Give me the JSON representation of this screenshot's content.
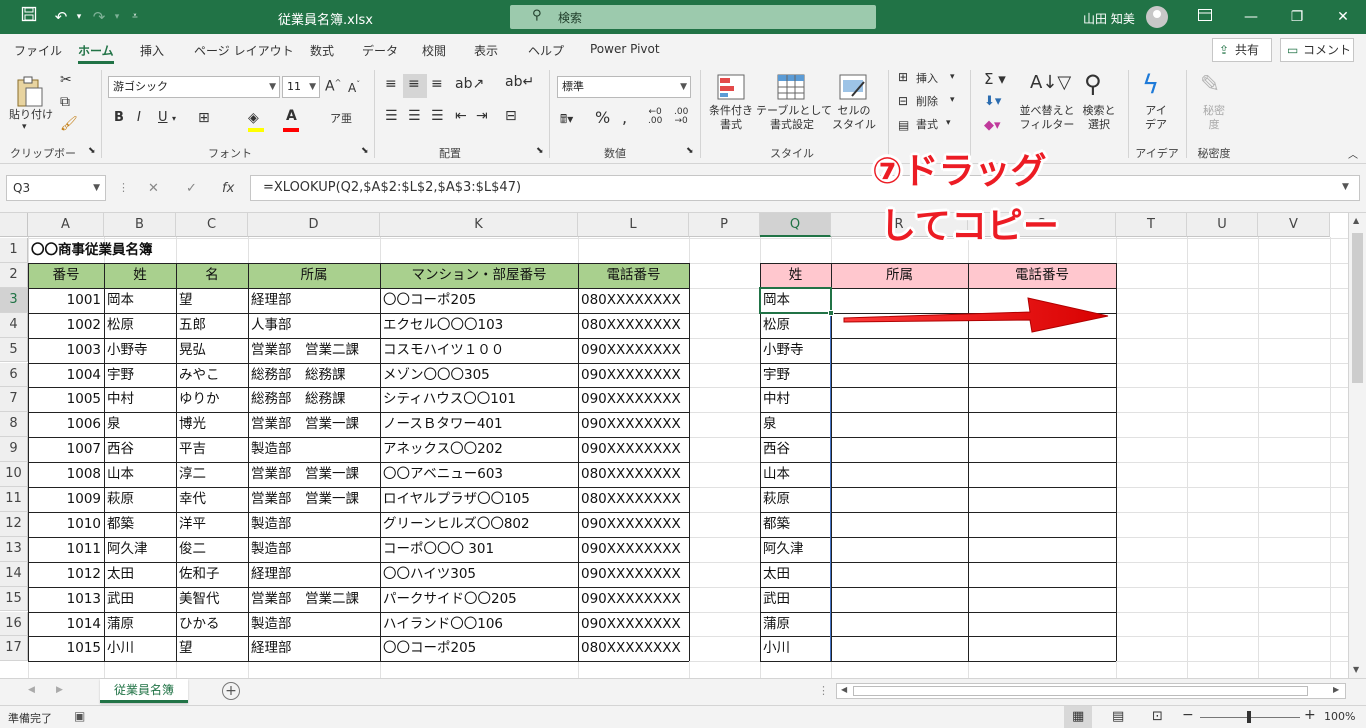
{
  "window": {
    "title": "従業員名簿.xlsx",
    "search_placeholder": "検索",
    "user": "山田 知美"
  },
  "menu": {
    "tabs": [
      "ファイル",
      "ホーム",
      "挿入",
      "ページ レイアウト",
      "数式",
      "データ",
      "校閲",
      "表示",
      "ヘルプ",
      "Power Pivot"
    ],
    "active_tab": "ホーム",
    "share_label": "共有",
    "comment_label": "コメント"
  },
  "ribbon": {
    "clipboard": {
      "paste": "貼り付け",
      "group": "クリップボード"
    },
    "font": {
      "name": "游ゴシック",
      "size": "11",
      "group": "フォント",
      "bold": "B",
      "italic": "I",
      "underline": "U"
    },
    "alignment": {
      "group": "配置"
    },
    "number": {
      "format": "標準",
      "group": "数値"
    },
    "styles": {
      "conditional": "条件付き\n書式",
      "table": "テーブルとして\n書式設定",
      "cell": "セルの\nスタイル",
      "group": "スタイル"
    },
    "cells": {
      "insert": "挿入",
      "delete": "削除",
      "format": "書式"
    },
    "editing": {
      "sort": "並べ替えと\nフィルター",
      "find": "検索と\n選択"
    },
    "ideas": {
      "label": "アイ\nデア",
      "group": "アイデア"
    },
    "sensitivity": {
      "label": "秘密\n度",
      "group": "秘密度"
    }
  },
  "formula_bar": {
    "name_box": "Q3",
    "formula": "=XLOOKUP(Q2,$A$2:$L$2,$A$3:$L$47)"
  },
  "sheet": {
    "columns": [
      "A",
      "B",
      "C",
      "D",
      "K",
      "L",
      "P",
      "Q",
      "R",
      "S",
      "T",
      "U",
      "V"
    ],
    "selected_column": "Q",
    "title": "〇〇商事従業員名簿",
    "headers": [
      "番号",
      "姓",
      "名",
      "所属",
      "マンション・部屋番号",
      "電話番号"
    ],
    "rows": [
      [
        "1001",
        "岡本",
        "望",
        "経理部",
        "〇〇コーポ205",
        "080XXXXXXXX"
      ],
      [
        "1002",
        "松原",
        "五郎",
        "人事部",
        "エクセル〇〇〇103",
        "080XXXXXXXX"
      ],
      [
        "1003",
        "小野寺",
        "晃弘",
        "営業部　営業二課",
        "コスモハイツ１００",
        "090XXXXXXXX"
      ],
      [
        "1004",
        "宇野",
        "みやこ",
        "総務部　総務課",
        "メゾン〇〇〇305",
        "090XXXXXXXX"
      ],
      [
        "1005",
        "中村",
        "ゆりか",
        "総務部　総務課",
        "シティハウス〇〇101",
        "090XXXXXXXX"
      ],
      [
        "1006",
        "泉",
        "博光",
        "営業部　営業一課",
        "ノースＢタワー401",
        "090XXXXXXXX"
      ],
      [
        "1007",
        "西谷",
        "平吉",
        "製造部",
        "アネックス〇〇202",
        "090XXXXXXXX"
      ],
      [
        "1008",
        "山本",
        "淳二",
        "営業部　営業一課",
        "〇〇アベニュー603",
        "080XXXXXXXX"
      ],
      [
        "1009",
        "萩原",
        "幸代",
        "営業部　営業一課",
        "ロイヤルプラザ〇〇105",
        "080XXXXXXXX"
      ],
      [
        "1010",
        "都築",
        "洋平",
        "製造部",
        "グリーンヒルズ〇〇802",
        "090XXXXXXXX"
      ],
      [
        "1011",
        "阿久津",
        "俊二",
        "製造部",
        "コーポ〇〇〇 301",
        "090XXXXXXXX"
      ],
      [
        "1012",
        "太田",
        "佐和子",
        "経理部",
        "〇〇ハイツ305",
        "090XXXXXXXX"
      ],
      [
        "1013",
        "武田",
        "美智代",
        "営業部　営業二課",
        "パークサイド〇〇205",
        "090XXXXXXXX"
      ],
      [
        "1014",
        "蒲原",
        "ひかる",
        "製造部",
        "ハイランド〇〇106",
        "090XXXXXXXX"
      ],
      [
        "1015",
        "小川",
        "望",
        "経理部",
        "〇〇コーポ205",
        "080XXXXXXXX"
      ]
    ],
    "lookup_headers": [
      "姓",
      "所属",
      "電話番号"
    ],
    "lookup_rows": [
      "岡本",
      "松原",
      "小野寺",
      "宇野",
      "中村",
      "泉",
      "西谷",
      "山本",
      "萩原",
      "都築",
      "阿久津",
      "太田",
      "武田",
      "蒲原",
      "小川"
    ],
    "row_numbers": [
      "1",
      "2",
      "3",
      "4",
      "5",
      "6",
      "7",
      "8",
      "9",
      "10",
      "11",
      "12",
      "13",
      "14",
      "15",
      "16",
      "17"
    ]
  },
  "annotation": {
    "line1": "⑦ドラッグ",
    "line2": "してコピー"
  },
  "sheet_tabs": {
    "active": "従業員名簿"
  },
  "status": {
    "ready": "準備完了",
    "zoom": "100%"
  },
  "colors": {
    "accent": "#217346",
    "header_green": "#a9d08e",
    "header_pink": "#ffc7ce",
    "annotation": "#ec1c24"
  }
}
